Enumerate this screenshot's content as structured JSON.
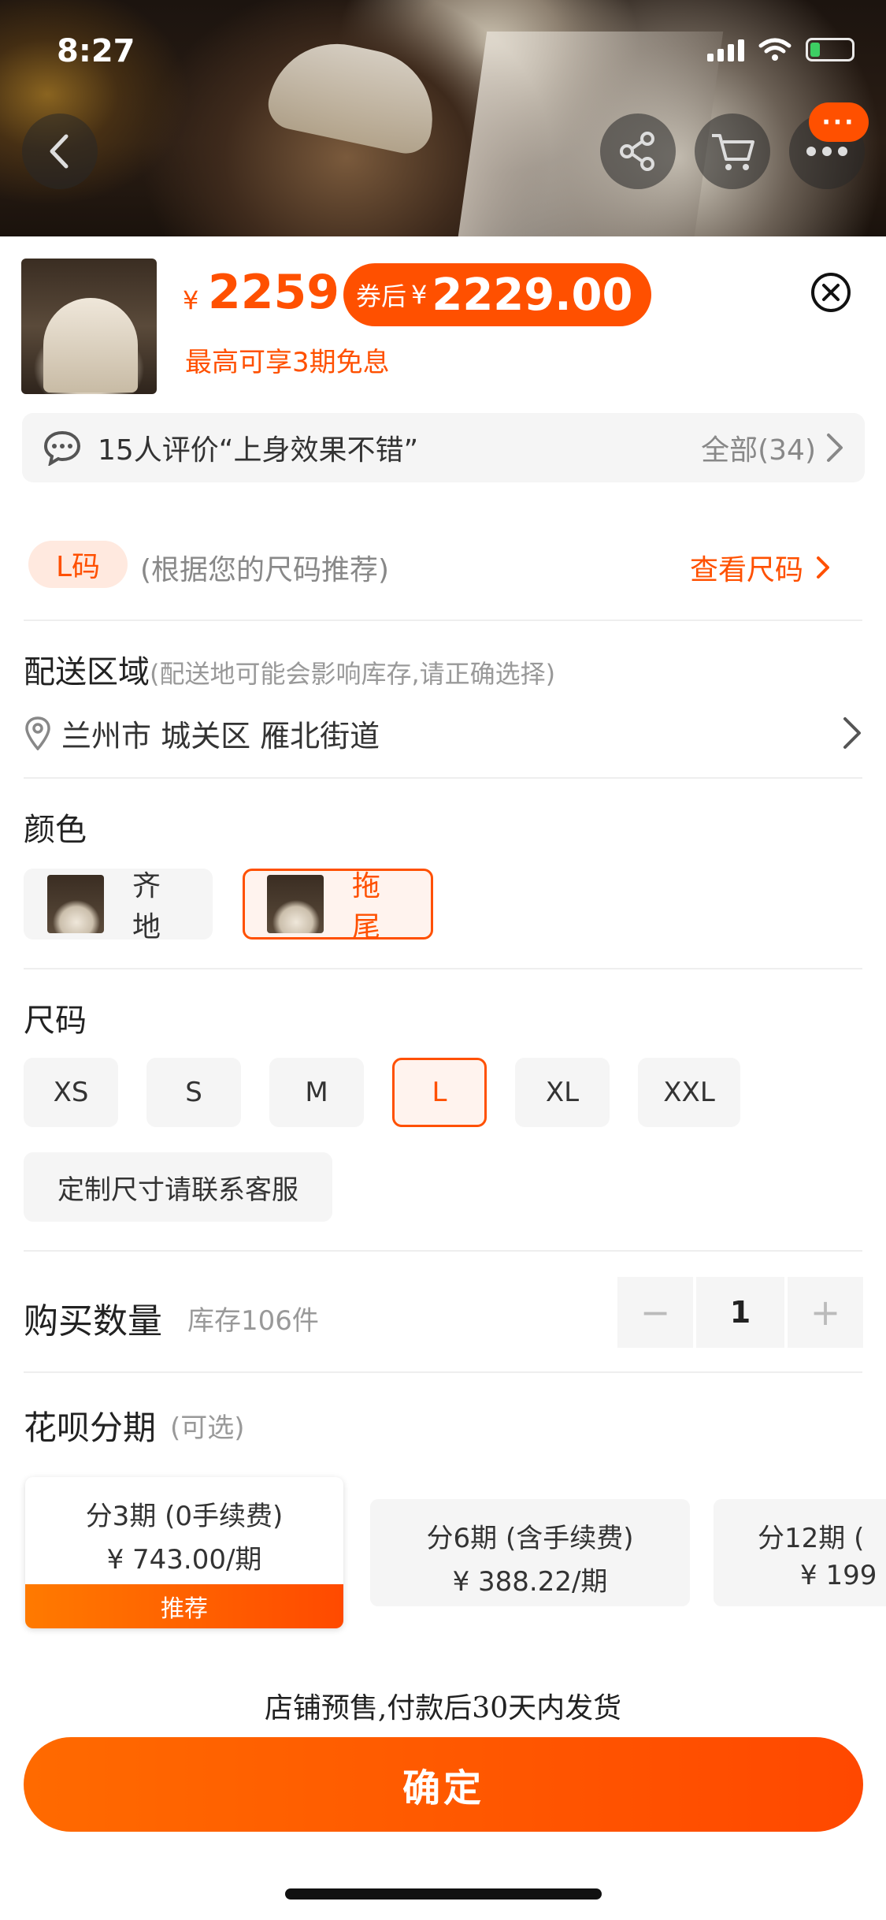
{
  "status": {
    "time": "8:27"
  },
  "header": {
    "more_badge": "···"
  },
  "product": {
    "currency": "¥",
    "price": "2259",
    "coupon_tag": "券后",
    "coupon_currency": "¥",
    "coupon_price": "2229.00",
    "installment_note": "最高可享3期免息"
  },
  "review": {
    "summary": "15人评价“上身效果不错”",
    "all_label": "全部(34)"
  },
  "size_rec": {
    "tag": "L码",
    "hint": "(根据您的尺码推荐)",
    "link": "查看尺码"
  },
  "delivery": {
    "title": "配送区域",
    "hint": "(配送地可能会影响库存,请正确选择)",
    "address": "兰州市 城关区 雁北街道"
  },
  "color": {
    "title": "颜色",
    "options": [
      {
        "label": "齐地",
        "selected": false
      },
      {
        "label": "拖尾",
        "selected": true
      }
    ]
  },
  "size": {
    "title": "尺码",
    "options": [
      "XS",
      "S",
      "M",
      "L",
      "XL",
      "XXL"
    ],
    "selected": "L",
    "custom": "定制尺寸请联系客服"
  },
  "quantity": {
    "label": "购买数量",
    "stock": "库存106件",
    "value": "1",
    "minus": "−",
    "plus": "+"
  },
  "huabei": {
    "title": "花呗分期",
    "optional": "(可选)",
    "plans": [
      {
        "term": "分3期 (0手续费)",
        "amount": "¥ 743.00/期",
        "badge": "推荐"
      },
      {
        "term": "分6期 (含手续费)",
        "amount": "¥ 388.22/期"
      },
      {
        "term": "分12期 (",
        "amount": "¥ 199"
      }
    ]
  },
  "presale_note": "店铺预售,付款后30天内发货",
  "confirm_label": "确定",
  "colors": {
    "accent": "#ff5000",
    "light_bg": "#f5f5f5"
  }
}
